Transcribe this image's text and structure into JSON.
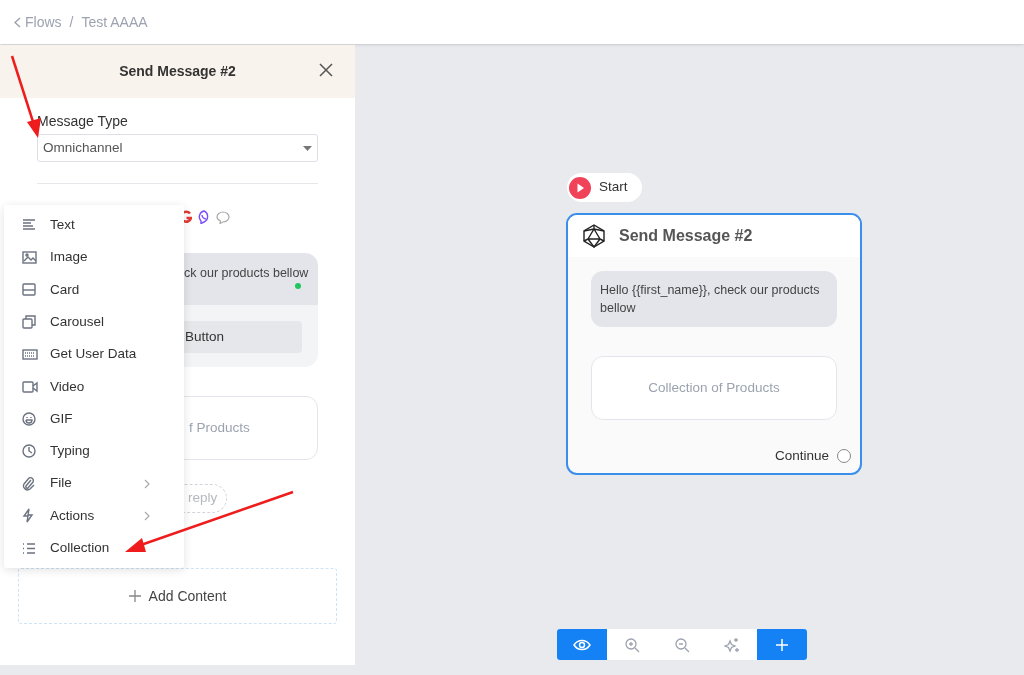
{
  "breadcrumb": {
    "parent": "Flows",
    "separator": "/",
    "current": "Test AAAA"
  },
  "panel": {
    "title": "Send Message #2",
    "message_type": {
      "label": "Message Type",
      "value": "Omnichannel"
    },
    "bubble_text": "ck our products bellow",
    "button_label": "Button",
    "collection_text": "f Products",
    "quick_reply": "reply",
    "add_content": "Add Content"
  },
  "menu": [
    {
      "label": "Text",
      "submenu": false
    },
    {
      "label": "Image",
      "submenu": false
    },
    {
      "label": "Card",
      "submenu": false
    },
    {
      "label": "Carousel",
      "submenu": false
    },
    {
      "label": "Get User Data",
      "submenu": false
    },
    {
      "label": "Video",
      "submenu": false
    },
    {
      "label": "GIF",
      "submenu": false
    },
    {
      "label": "Typing",
      "submenu": false
    },
    {
      "label": "File",
      "submenu": true
    },
    {
      "label": "Actions",
      "submenu": true
    },
    {
      "label": "Collection",
      "submenu": false
    }
  ],
  "canvas": {
    "start": "Start",
    "node": {
      "title": "Send Message #2",
      "message": "Hello {{first_name}}, check our products bellow",
      "collection": "Collection of Products",
      "continue": "Continue"
    },
    "toolbar": [
      {
        "selected": true
      },
      {
        "selected": false
      },
      {
        "selected": false
      },
      {
        "selected": false
      },
      {
        "selected": true
      }
    ]
  }
}
